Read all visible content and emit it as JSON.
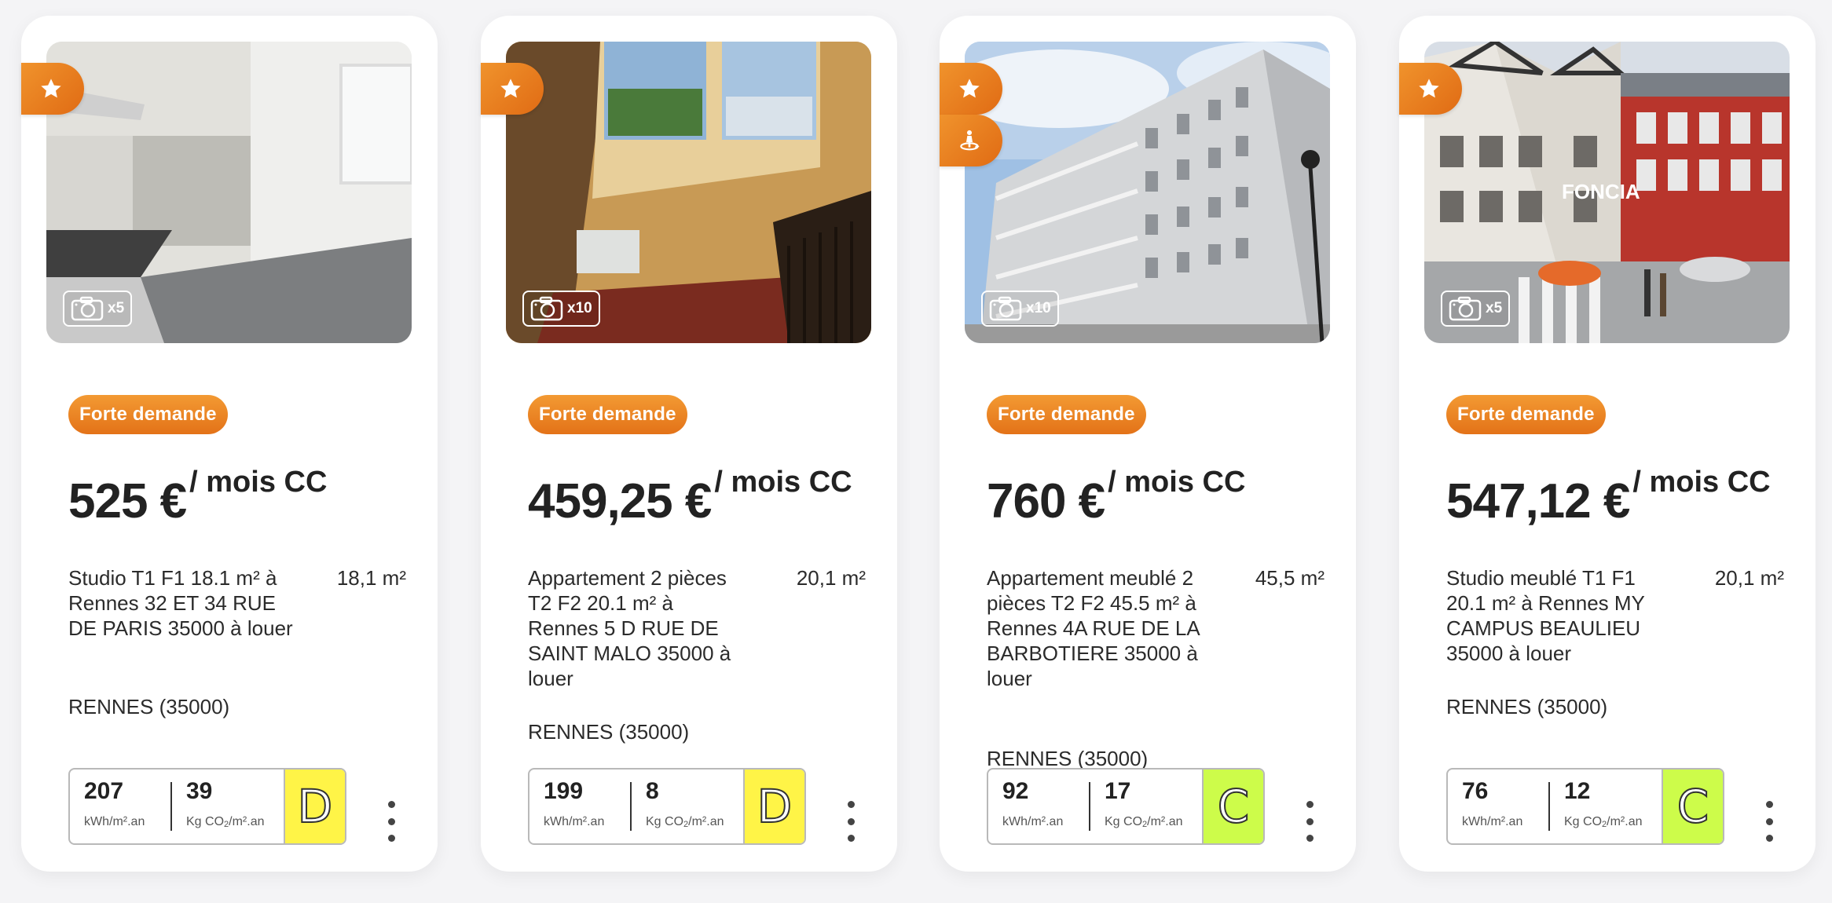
{
  "colors": {
    "accent": "#e8791d",
    "dpe_D": "#fff447",
    "dpe_C": "#cdfc4a"
  },
  "cards": [
    {
      "photo_count": "x5",
      "badge": "Forte demande",
      "price": "525 €",
      "price_unit": "/ mois CC",
      "description": "Studio T1 F1 18.1 m² à Rennes 32 ET 34 RUE DE PARIS 35000 à louer",
      "area": "18,1 m²",
      "city": "RENNES (35000)",
      "energy_value": "207",
      "energy_unit": "kWh/m².an",
      "ges_value": "39",
      "ges_unit_prefix": "Kg CO",
      "ges_unit_sub": "2",
      "ges_unit_suffix": "/m².an",
      "dpe_class": "D",
      "flags": [
        "star-icon"
      ]
    },
    {
      "photo_count": "x10",
      "badge": "Forte demande",
      "price": "459,25 €",
      "price_unit": "/ mois CC",
      "description": "Appartement 2 pièces T2 F2 20.1 m² à Rennes 5 D RUE DE SAINT MALO 35000 à louer",
      "area": "20,1 m²",
      "city": "RENNES (35000)",
      "energy_value": "199",
      "energy_unit": "kWh/m².an",
      "ges_value": "8",
      "ges_unit_prefix": "Kg CO",
      "ges_unit_sub": "2",
      "ges_unit_suffix": "/m².an",
      "dpe_class": "D",
      "flags": [
        "star-icon"
      ]
    },
    {
      "photo_count": "x10",
      "badge": "Forte demande",
      "price": "760 €",
      "price_unit": "/ mois CC",
      "description": "Appartement meublé 2 pièces T2 F2 45.5 m² à Rennes 4A RUE DE LA BARBOTIERE 35000 à louer",
      "area": "45,5 m²",
      "city": "RENNES (35000)",
      "energy_value": "92",
      "energy_unit": "kWh/m².an",
      "ges_value": "17",
      "ges_unit_prefix": "Kg CO",
      "ges_unit_sub": "2",
      "ges_unit_suffix": "/m².an",
      "dpe_class": "C",
      "flags": [
        "star-icon",
        "virtual-visit-icon"
      ]
    },
    {
      "photo_count": "x5",
      "badge": "Forte demande",
      "price": "547,12 €",
      "price_unit": "/ mois CC",
      "description": "Studio meublé T1 F1 20.1 m² à Rennes MY CAMPUS BEAULIEU 35000 à louer",
      "area": "20,1 m²",
      "city": "RENNES (35000)",
      "energy_value": "76",
      "energy_unit": "kWh/m².an",
      "ges_value": "12",
      "ges_unit_prefix": "Kg CO",
      "ges_unit_sub": "2",
      "ges_unit_suffix": "/m².an",
      "dpe_class": "C",
      "flags": [
        "star-icon"
      ],
      "photo_watermark": "FONCIA"
    }
  ]
}
